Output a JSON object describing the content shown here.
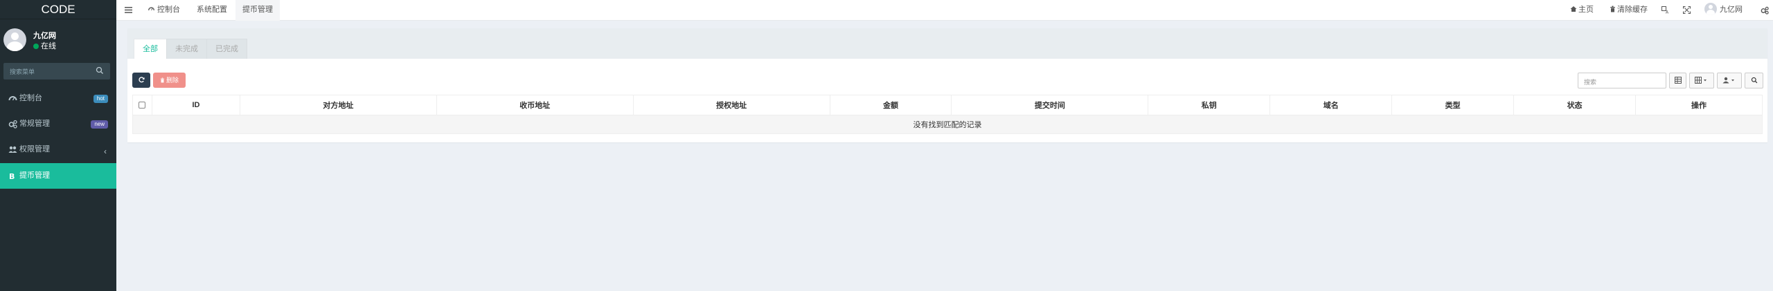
{
  "sidebar": {
    "logo": "CODE",
    "user": {
      "name": "九亿网",
      "status": "在线"
    },
    "search_placeholder": "搜索菜单",
    "items": [
      {
        "label": "控制台",
        "badge": "hot"
      },
      {
        "label": "常规管理",
        "badge": "new"
      },
      {
        "label": "权限管理",
        "chevron": "‹"
      },
      {
        "label": "提币管理"
      }
    ]
  },
  "topnav": {
    "tabs": [
      "控制台",
      "系统配置",
      "提币管理"
    ],
    "home": "主页",
    "clear_cache": "清除缓存",
    "user": "九亿网"
  },
  "content": {
    "tabs": [
      "全部",
      "未完成",
      "已完成"
    ],
    "delete_label": "删除",
    "search_placeholder": "搜索",
    "columns": [
      "ID",
      "对方地址",
      "收币地址",
      "授权地址",
      "金额",
      "提交时间",
      "私钥",
      "域名",
      "类型",
      "状态",
      "操作"
    ],
    "empty_text": "没有找到匹配的记录"
  },
  "colors": {
    "sidebar_bg": "#222d32",
    "accent": "#1abc9c",
    "danger": "#f0908a",
    "dark_btn": "#2c3e50"
  }
}
